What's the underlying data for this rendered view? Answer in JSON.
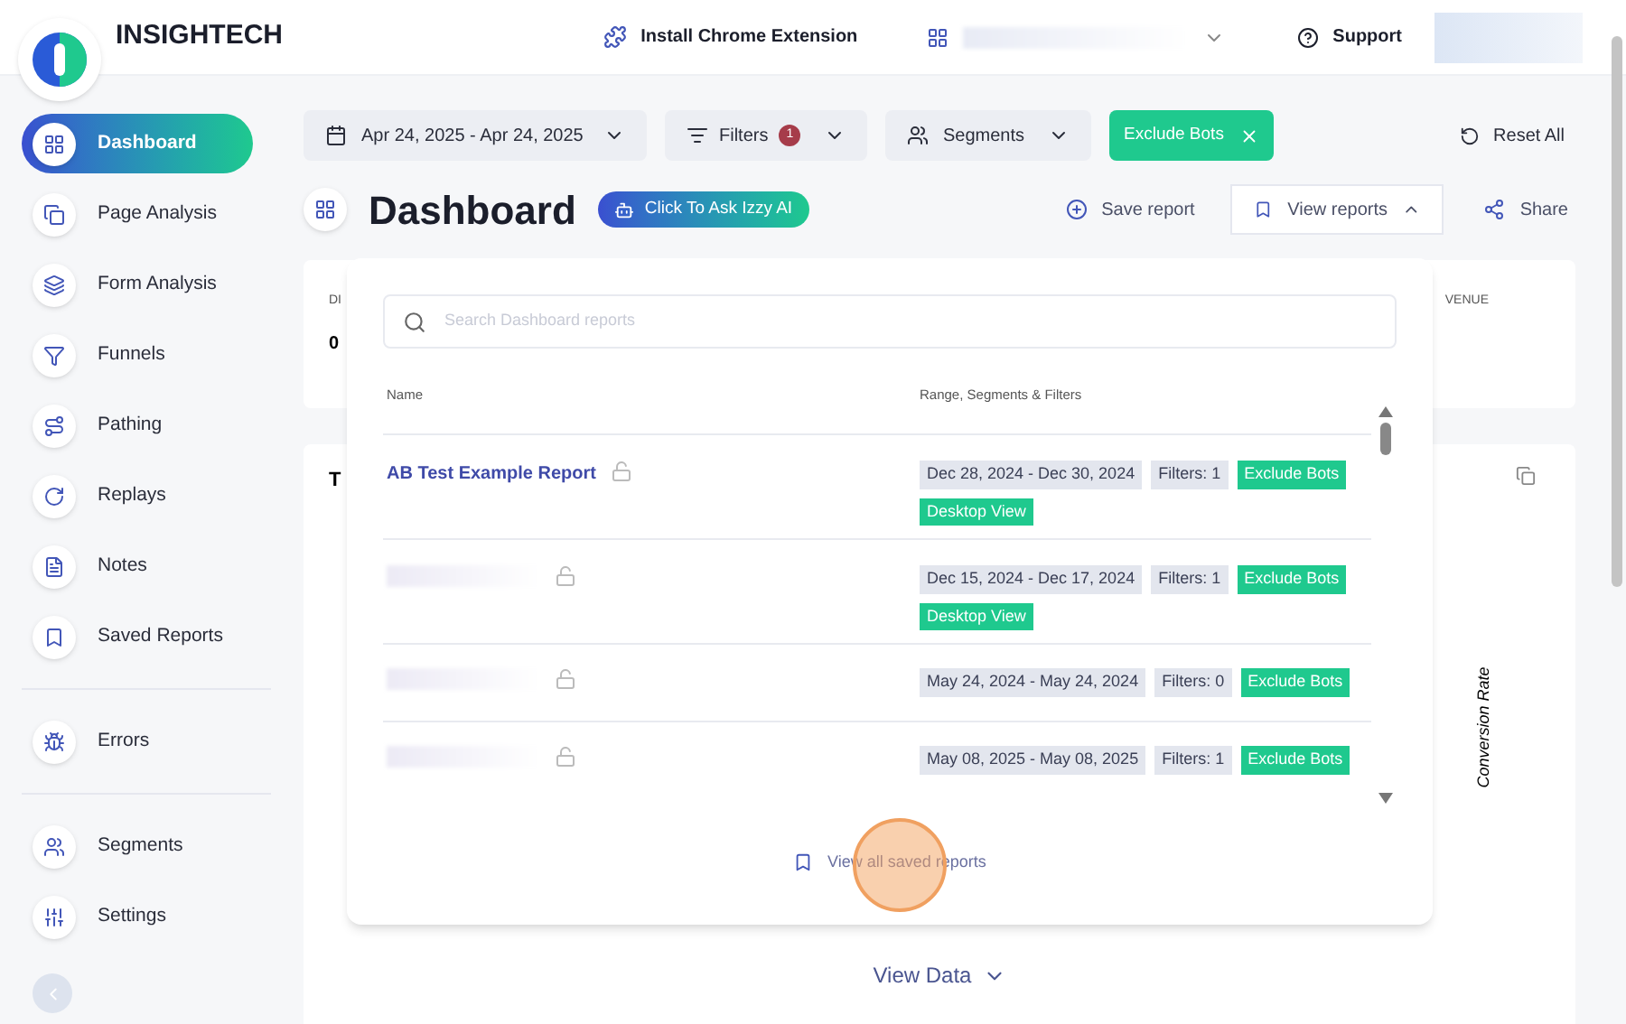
{
  "header": {
    "brand": "INSIGHTECH",
    "extension": "Install Chrome Extension",
    "support": "Support"
  },
  "sidebar": {
    "groups": [
      [
        {
          "label": "Dashboard",
          "selected": true
        },
        {
          "label": "Page Analysis",
          "selected": false
        },
        {
          "label": "Form Analysis",
          "selected": false
        },
        {
          "label": "Funnels",
          "selected": false
        },
        {
          "label": "Pathing",
          "selected": false
        },
        {
          "label": "Replays",
          "selected": false
        },
        {
          "label": "Notes",
          "selected": false
        },
        {
          "label": "Saved Reports",
          "selected": false
        }
      ],
      [
        {
          "label": "Errors",
          "selected": false
        }
      ],
      [
        {
          "label": "Segments",
          "selected": false
        },
        {
          "label": "Settings",
          "selected": false
        }
      ]
    ]
  },
  "toolbar": {
    "date_range": "Apr 24, 2025 - Apr 24, 2025",
    "filters": "Filters",
    "filters_count": "1",
    "segments": "Segments",
    "exclude": "Exclude Bots",
    "reset": "Reset All"
  },
  "page": {
    "title": "Dashboard",
    "ask": "Click To Ask Izzy AI",
    "save": "Save report",
    "view_reports": "View reports",
    "view_reports_expanded": true,
    "share": "Share"
  },
  "background": {
    "metric_label": "DI",
    "metric_value": "0",
    "metric_label_right": "VENUE",
    "chart_title": "T",
    "axis_label": "Conversion Rate",
    "view_data": "View Data"
  },
  "reports_menu": {
    "search_placeholder": "Search Dashboard reports",
    "columns": [
      "Name",
      "Range, Segments & Filters"
    ],
    "rows": [
      {
        "name": "AB Test Example Report",
        "tags": [
          {
            "kind": "range",
            "text": "Dec 28, 2024 - Dec 30, 2024"
          },
          {
            "kind": "count",
            "text": "Filters: 1"
          },
          {
            "kind": "flag",
            "text": "Exclude Bots"
          },
          {
            "kind": "flag",
            "text": "Desktop View"
          }
        ]
      },
      {
        "tags": [
          {
            "kind": "range",
            "text": "Dec 15, 2024 - Dec 17, 2024"
          },
          {
            "kind": "count",
            "text": "Filters: 1"
          },
          {
            "kind": "flag",
            "text": "Exclude Bots"
          },
          {
            "kind": "flag",
            "text": "Desktop View"
          }
        ]
      },
      {
        "tags": [
          {
            "kind": "range",
            "text": "May 24, 2024 - May 24, 2024"
          },
          {
            "kind": "count",
            "text": "Filters: 0"
          },
          {
            "kind": "flag",
            "text": "Exclude Bots"
          }
        ]
      },
      {
        "tags": [
          {
            "kind": "range",
            "text": "May 08, 2025 - May 08, 2025"
          },
          {
            "kind": "count",
            "text": "Filters: 1"
          },
          {
            "kind": "flag",
            "text": "Exclude Bots"
          }
        ]
      }
    ],
    "footer": "View all saved reports"
  }
}
